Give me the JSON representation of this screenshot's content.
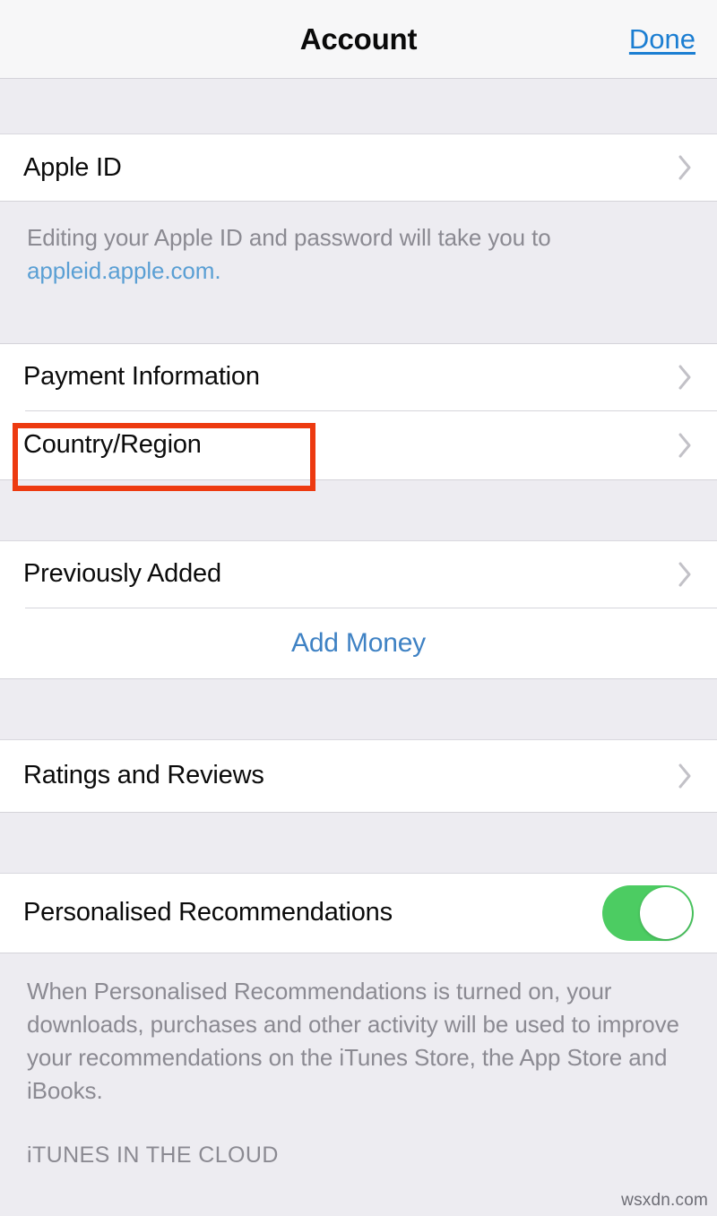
{
  "navbar": {
    "title": "Account",
    "done_label": "Done",
    "done_color": "#1b7ed2"
  },
  "sections": {
    "apple_id": {
      "rows": [
        {
          "label": "Apple ID",
          "accessory": "chevron-right-icon"
        }
      ],
      "footer_prefix": "Editing your Apple ID and password will take you to ",
      "footer_link": "appleid.apple.com."
    },
    "payment": {
      "rows": [
        {
          "label": "Payment Information",
          "accessory": "chevron-right-icon"
        },
        {
          "label": "Country/Region",
          "accessory": "chevron-right-icon",
          "highlighted": true
        }
      ]
    },
    "money": {
      "rows": [
        {
          "label": "Previously Added",
          "accessory": "chevron-right-icon"
        }
      ],
      "action_label": "Add Money"
    },
    "ratings": {
      "rows": [
        {
          "label": "Ratings and Reviews",
          "accessory": "chevron-right-icon"
        }
      ]
    },
    "recommendations": {
      "rows": [
        {
          "label": "Personalised Recommendations",
          "accessory": "toggle-switch",
          "toggle_on": true
        }
      ],
      "footer_text": "When Personalised Recommendations is turned on, your downloads, purchases and other activity will be used to improve your recommendations on the iTunes Store, the App Store and iBooks."
    },
    "itunes_cloud": {
      "header": "iTUNES IN THE CLOUD"
    }
  },
  "annotation": {
    "color": "#ed3a10",
    "target": "Country/Region"
  },
  "watermark": "wsxdn.com",
  "colors": {
    "toggle_on": "#4ccc62",
    "link_blue": "#5a9fd4",
    "action_blue": "#3f82c4",
    "group_bg": "#ffffff",
    "page_bg": "#edecf1"
  }
}
